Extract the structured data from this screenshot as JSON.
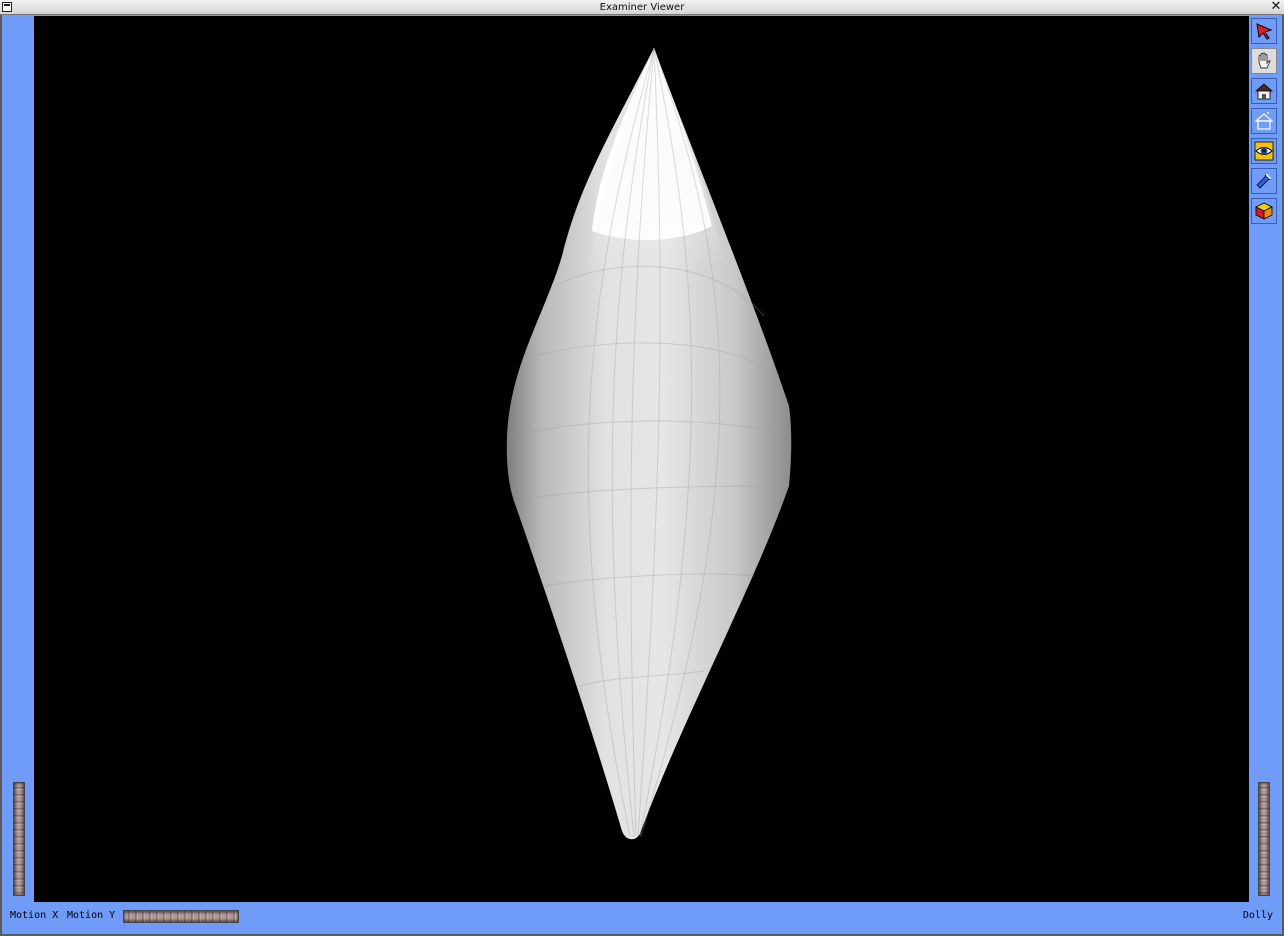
{
  "window": {
    "title": "Examiner Viewer"
  },
  "toolbar": {
    "buttons": [
      {
        "name": "select-button",
        "icon": "arrow-pointer-icon",
        "active": false
      },
      {
        "name": "view-button",
        "icon": "hand-icon",
        "active": true
      },
      {
        "name": "home-button",
        "icon": "home-icon",
        "active": false
      },
      {
        "name": "set-home-button",
        "icon": "set-home-icon",
        "active": false
      },
      {
        "name": "view-all-button",
        "icon": "eye-icon",
        "active": false
      },
      {
        "name": "seek-button",
        "icon": "flashlight-icon",
        "active": false
      },
      {
        "name": "projection-button",
        "icon": "cube-icon",
        "active": false
      }
    ]
  },
  "bottom_bar": {
    "motion_x_label": "Motion X",
    "motion_y_label": "Motion Y",
    "dolly_label": "Dolly"
  },
  "colors": {
    "panel": "#6f9bf9",
    "viewport_background": "#000000",
    "model": "#e8e8e8"
  }
}
